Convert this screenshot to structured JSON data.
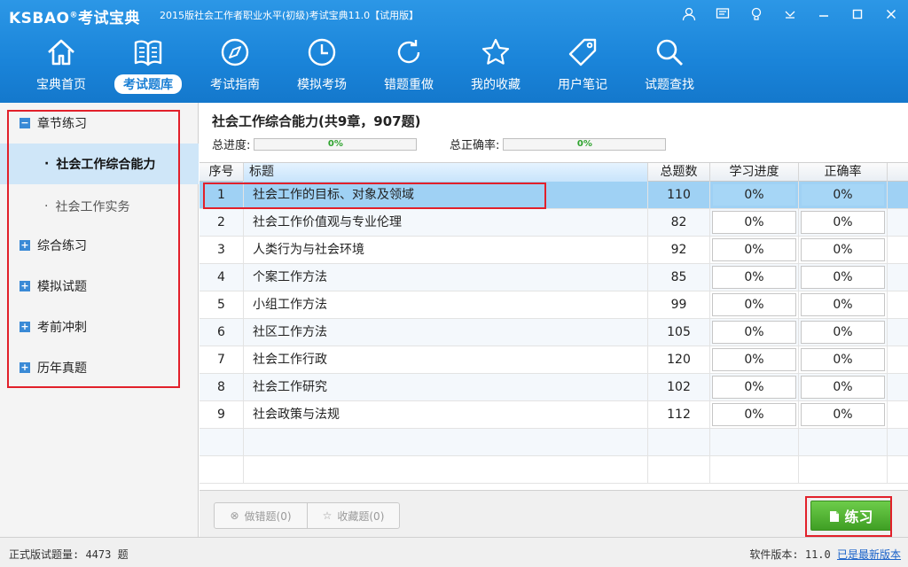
{
  "app": {
    "logo_text": "KSBAO",
    "logo_reg": "®",
    "logo_cn": "考试宝典",
    "window_title": "2015版社会工作者职业水平(初级)考试宝典11.0【试用版】"
  },
  "nav": [
    {
      "label": "宝典首页",
      "icon": "home-icon"
    },
    {
      "label": "考试题库",
      "icon": "book-icon",
      "active": true
    },
    {
      "label": "考试指南",
      "icon": "compass-icon"
    },
    {
      "label": "模拟考场",
      "icon": "clock-icon"
    },
    {
      "label": "错题重做",
      "icon": "refresh-icon"
    },
    {
      "label": "我的收藏",
      "icon": "star-icon"
    },
    {
      "label": "用户笔记",
      "icon": "tag-icon"
    },
    {
      "label": "试题查找",
      "icon": "search-icon"
    }
  ],
  "sidebar": {
    "groups": [
      {
        "label": "章节练习",
        "toggle": "−"
      },
      {
        "label": "综合练习",
        "toggle": "+"
      },
      {
        "label": "模拟试题",
        "toggle": "+"
      },
      {
        "label": "考前冲刺",
        "toggle": "+"
      },
      {
        "label": "历年真题",
        "toggle": "+"
      }
    ],
    "subitems": [
      {
        "label": "社会工作综合能力",
        "bullet": "·",
        "selected": true
      },
      {
        "label": "社会工作实务",
        "bullet": "·",
        "selected": false
      }
    ]
  },
  "main": {
    "title": "社会工作综合能力(共9章，907题)",
    "progress_label": "总进度:",
    "progress_value": "0%",
    "accuracy_label": "总正确率:",
    "accuracy_value": "0%"
  },
  "table": {
    "headers": {
      "idx": "序号",
      "title": "标题",
      "total": "总题数",
      "progress": "学习进度",
      "accuracy": "正确率"
    },
    "rows": [
      {
        "idx": "1",
        "title": "社会工作的目标、对象及领域",
        "total": "110",
        "progress": "0%",
        "accuracy": "0%"
      },
      {
        "idx": "2",
        "title": "社会工作价值观与专业伦理",
        "total": "82",
        "progress": "0%",
        "accuracy": "0%"
      },
      {
        "idx": "3",
        "title": "人类行为与社会环境",
        "total": "92",
        "progress": "0%",
        "accuracy": "0%"
      },
      {
        "idx": "4",
        "title": "个案工作方法",
        "total": "85",
        "progress": "0%",
        "accuracy": "0%"
      },
      {
        "idx": "5",
        "title": "小组工作方法",
        "total": "99",
        "progress": "0%",
        "accuracy": "0%"
      },
      {
        "idx": "6",
        "title": "社区工作方法",
        "total": "105",
        "progress": "0%",
        "accuracy": "0%"
      },
      {
        "idx": "7",
        "title": "社会工作行政",
        "total": "120",
        "progress": "0%",
        "accuracy": "0%"
      },
      {
        "idx": "8",
        "title": "社会工作研究",
        "total": "102",
        "progress": "0%",
        "accuracy": "0%"
      },
      {
        "idx": "9",
        "title": "社会政策与法规",
        "total": "112",
        "progress": "0%",
        "accuracy": "0%"
      }
    ]
  },
  "buttons": {
    "wrong_redo": "做错题(0)",
    "favorites": "收藏题(0)",
    "practice": "练习"
  },
  "status": {
    "left": "正式版试题量: 4473 题",
    "version_label": "软件版本: 11.0",
    "latest": "已是最新版本"
  },
  "colors": {
    "accent": "#1a84d9",
    "highlight": "#e2202a",
    "practice": "#4caf2e"
  }
}
